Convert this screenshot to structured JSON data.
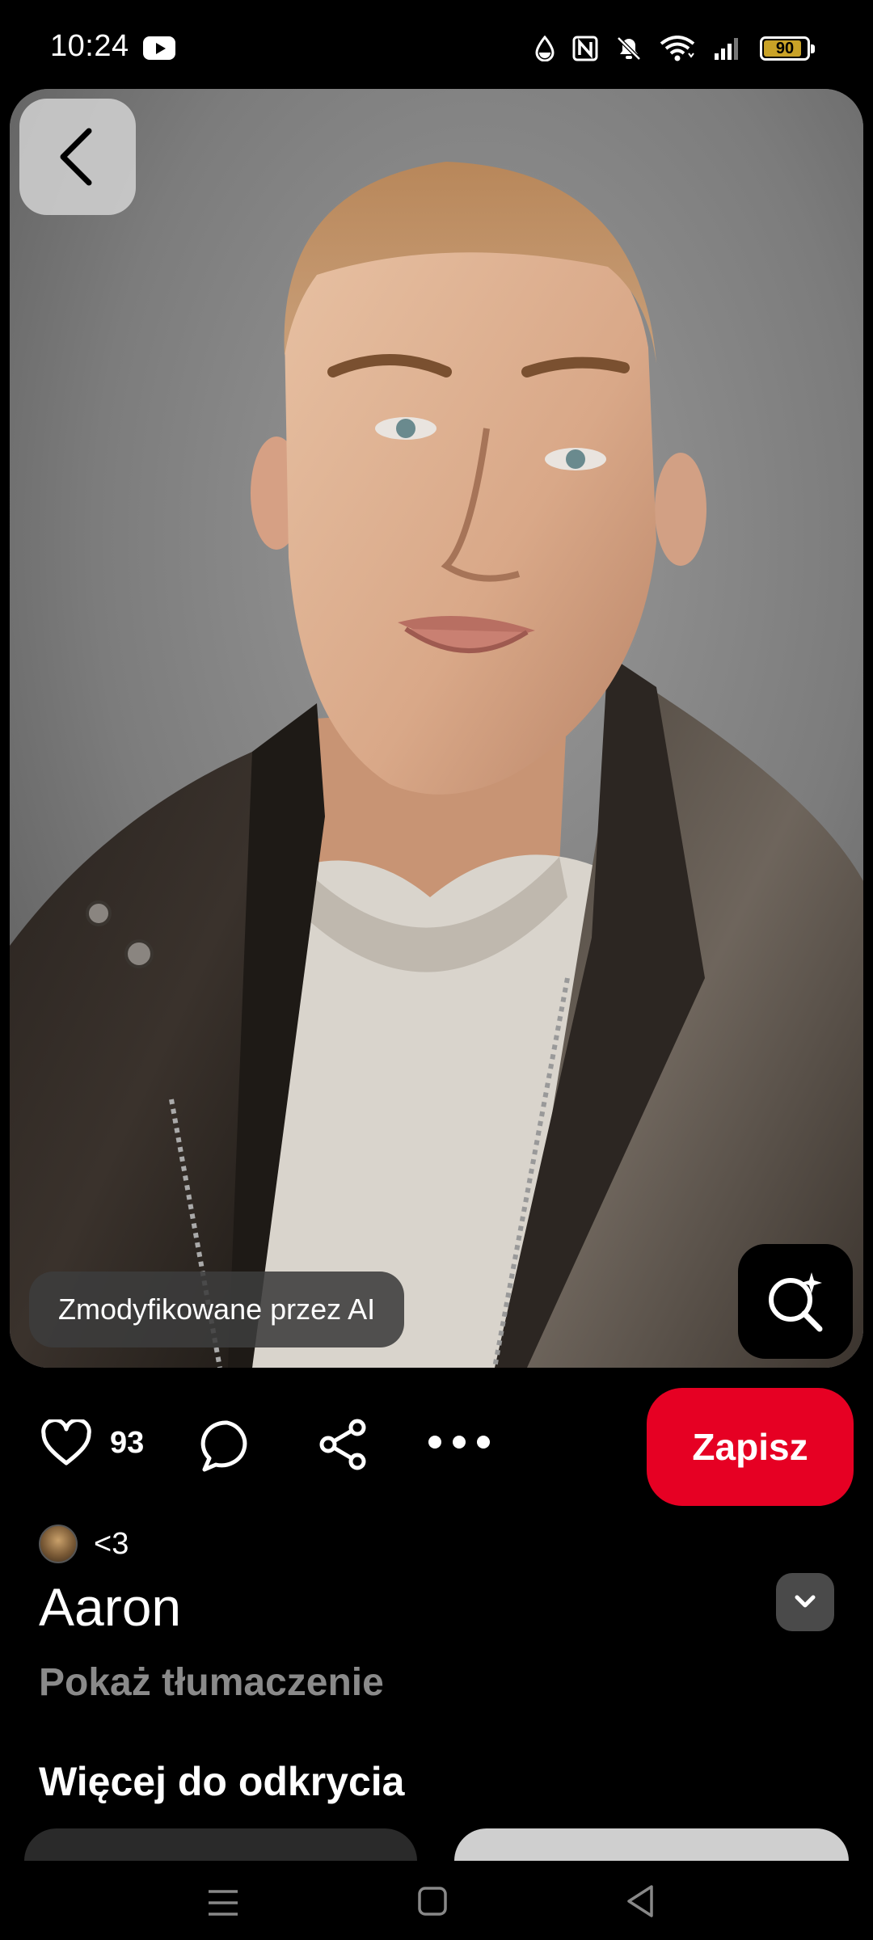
{
  "status_bar": {
    "time": "10:24",
    "battery_level": "90",
    "battery_percent": 90,
    "icons": [
      "youtube-icon",
      "data-saver-icon",
      "nfc-icon",
      "mute-icon",
      "wifi-icon",
      "signal-icon",
      "battery-icon"
    ]
  },
  "pin": {
    "ai_label": "Zmodyfikowane przez AI",
    "like_count": "93",
    "save_label": "Zapisz",
    "creator_name": "<3",
    "title": "Aaron",
    "translate_label": "Pokaż tłumaczenie",
    "more_heading": "Więcej do odkrycia"
  },
  "colors": {
    "accent": "#e60023",
    "background": "#000000",
    "muted_text": "#8a8a8a",
    "battery_fill": "#c9a227"
  }
}
